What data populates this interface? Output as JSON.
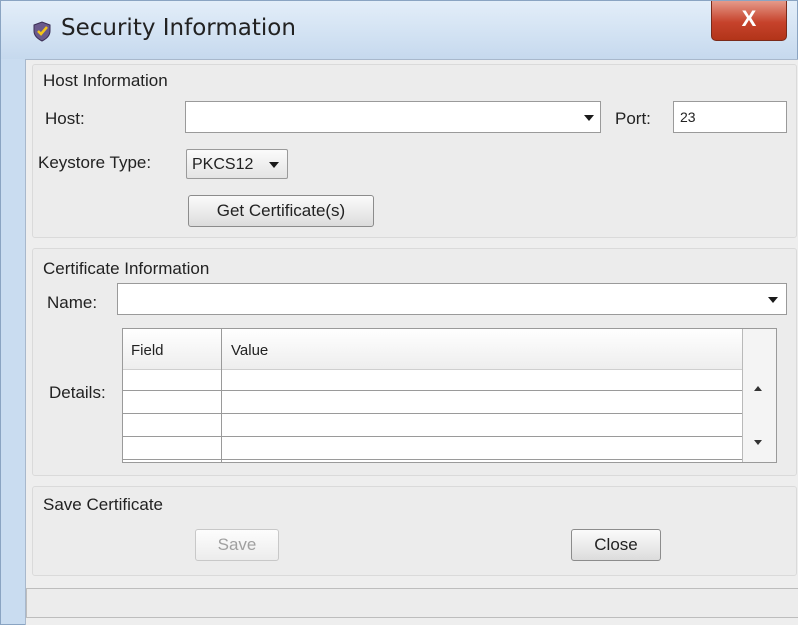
{
  "window": {
    "title": "Security Information",
    "close_label": "X"
  },
  "host_info": {
    "section_title": "Host Information",
    "host_label": "Host:",
    "host_value": "",
    "port_label": "Port:",
    "port_value": "23",
    "keystore_label": "Keystore Type:",
    "keystore_value": "PKCS12",
    "get_cert_label": "Get Certificate(s)"
  },
  "cert_info": {
    "section_title": "Certificate Information",
    "name_label": "Name:",
    "name_value": "",
    "details_label": "Details:",
    "columns": [
      "Field",
      "Value"
    ]
  },
  "save_cert": {
    "section_title": "Save Certificate",
    "save_label": "Save",
    "close_label": "Close"
  },
  "status_text": ""
}
